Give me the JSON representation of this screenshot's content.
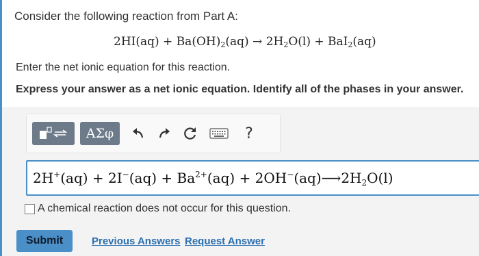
{
  "problem": {
    "prompt": "Consider the following reaction from Part A:",
    "reaction": {
      "p1": "2HI(aq) + Ba(OH)",
      "s1": "2",
      "p2": "(aq) → 2H",
      "s2": "2",
      "p3": "O(l) + BaI",
      "s3": "2",
      "p4": "(aq)"
    },
    "instruction": "Enter the net ionic equation for this reaction.",
    "express": "Express your answer as a net ionic equation. Identify all of the phases in your answer."
  },
  "toolbar": {
    "greek_label": "ΑΣφ",
    "help_label": "?",
    "icons": [
      "template-icon",
      "undo-icon",
      "redo-icon",
      "reset-icon",
      "keyboard-icon",
      "help-icon"
    ]
  },
  "answer": {
    "t1": "2H",
    "sup1": "+",
    "t2": "(aq) + 2I",
    "sup2": "−",
    "t3": "(aq) + Ba",
    "sup3": "2+",
    "t4": "(aq) + 2OH",
    "sup4": "−",
    "t5": "(aq)⟶2H",
    "sub5": "2",
    "t6": "O(l)"
  },
  "no_reaction_label": "A chemical reaction does not occur for this question.",
  "actions": {
    "submit_label": "Submit",
    "previous_answers_label": "Previous Answers",
    "request_answer_label": "Request Answer"
  },
  "colors": {
    "accent": "#4a8fc8",
    "toolbar_button": "#6c7a89",
    "link": "#2a6fb0"
  }
}
